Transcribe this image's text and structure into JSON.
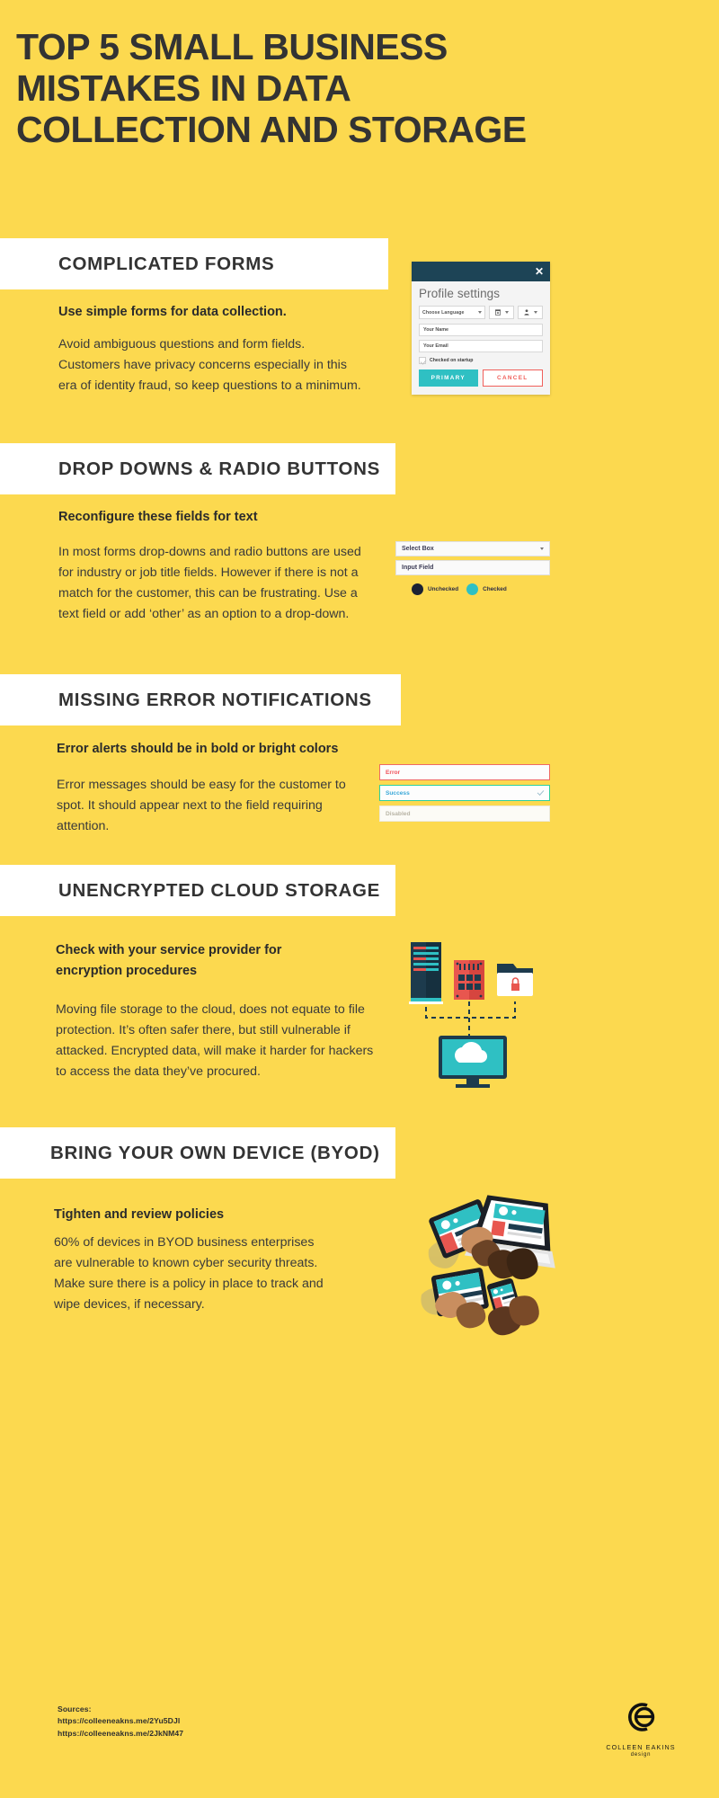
{
  "colors": {
    "background": "#fcd94f",
    "banner": "#ffffff",
    "heading_text": "#333333",
    "teal": "#2fc0c3",
    "dark_navy": "#1d4456",
    "red": "#f05f5a",
    "success_green": "#2ecfa0"
  },
  "title": "TOP 5 SMALL BUSINESS MISTAKES IN DATA COLLECTION AND STORAGE",
  "sections": [
    {
      "heading": "COMPLICATED FORMS",
      "lede": "Use simple forms for data collection.",
      "body": "Avoid ambiguous questions and form fields. Customers have privacy concerns especially in this era of identity fraud, so keep questions to a minimum."
    },
    {
      "heading": "DROP DOWNS & RADIO BUTTONS",
      "lede": "Reconfigure these fields for text",
      "body": "In most forms drop-downs and radio buttons are used for industry or job title fields. However if there is not a match for the customer, this can be frustrating. Use a text field or add ‘other’ as an option to a drop-down."
    },
    {
      "heading": "MISSING ERROR NOTIFICATIONS",
      "lede": "Error alerts should be in bold or bright colors",
      "body": "Error messages should be easy for the customer to spot. It should appear next to the field requiring attention."
    },
    {
      "heading": "UNENCRYPTED CLOUD STORAGE",
      "lede": "Check with your service provider for encryption procedures",
      "body": "Moving file storage to the cloud, does not equate to file protection. It’s often safer there, but still vulnerable if attacked. Encrypted data, will make it harder for hackers to access the data they’ve procured."
    },
    {
      "heading": "BRING YOUR OWN DEVICE (BYOD)",
      "lede": "Tighten and review policies",
      "body": "60% of devices in BYOD business enterprises are vulnerable to known cyber security threats. Make sure there is a policy in place to track and wipe devices, if necessary."
    }
  ],
  "profile_dialog": {
    "title": "Profile settings",
    "close_label": "✕",
    "language_select": "Choose Language",
    "name_placeholder": "Your Name",
    "email_placeholder": "Your Email",
    "checkbox_label": "Checked on startup",
    "primary_button": "PRIMARY",
    "cancel_button": "CANCEL"
  },
  "form_widgets": {
    "select_box": "Select Box",
    "input_field": "Input Field",
    "unchecked_label": "Unchecked",
    "checked_label": "Checked"
  },
  "alert_widgets": {
    "error": "Error",
    "success": "Success",
    "disabled": "Disabled"
  },
  "footer": {
    "sources_label": "Sources:",
    "source_1": "https://colleeneakns.me/2Yu5DJl",
    "source_2": "https://colleeneakns.me/2JkNM47",
    "logo_name": "COLLEEN EAKINS",
    "logo_sub": "design"
  }
}
